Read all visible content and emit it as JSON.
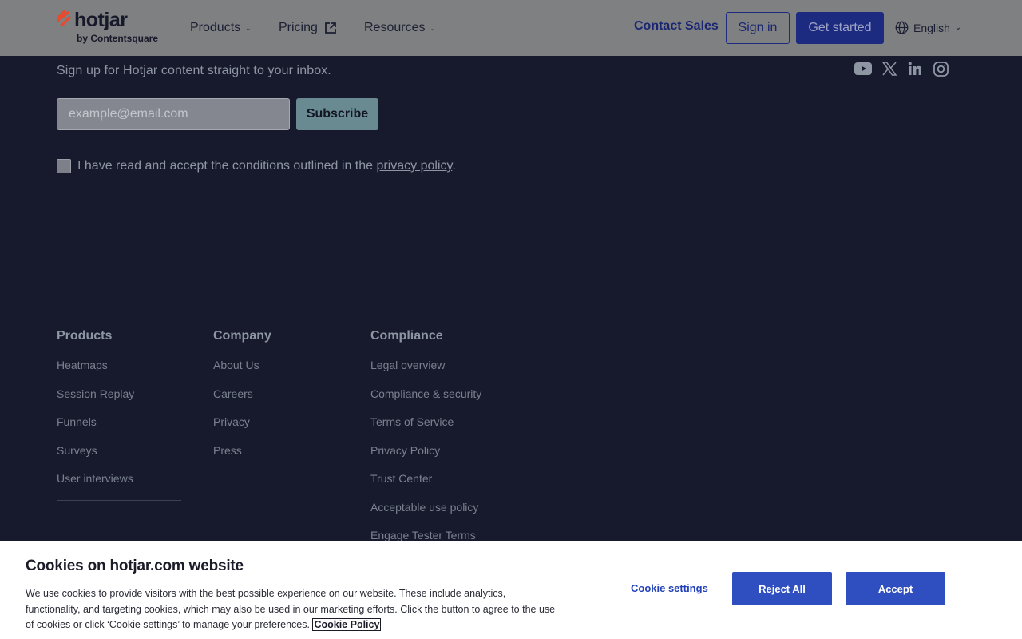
{
  "header": {
    "logo_text": "hotjar",
    "logo_sub": "by Contentsquare",
    "nav": [
      {
        "label": "Products",
        "icon": "chevron-down-icon"
      },
      {
        "label": "Pricing",
        "icon": "external-link-icon"
      },
      {
        "label": "Resources",
        "icon": "chevron-down-icon"
      }
    ],
    "contact_sales": "Contact Sales",
    "sign_in": "Sign in",
    "get_started": "Get started",
    "language": "English"
  },
  "newsletter": {
    "tagline": "Sign up for Hotjar content straight to your inbox.",
    "email_placeholder": "example@email.com",
    "subscribe": "Subscribe",
    "consent_prefix": "I have read and accept the conditions outlined in the ",
    "consent_link": "privacy policy",
    "consent_suffix": "."
  },
  "social": [
    "youtube-icon",
    "x-icon",
    "linkedin-icon",
    "instagram-icon"
  ],
  "columns": [
    {
      "title": "Products",
      "links": [
        "Heatmaps",
        "Session Replay",
        "Funnels",
        "Surveys",
        "User interviews"
      ]
    },
    {
      "title": "Company",
      "links": [
        "About Us",
        "Careers",
        "Privacy",
        "Press"
      ]
    },
    {
      "title": "Compliance",
      "links": [
        "Legal overview",
        "Compliance & security",
        "Terms of Service",
        "Privacy Policy",
        "Trust Center",
        "Acceptable use policy",
        "Engage Tester Terms"
      ]
    }
  ],
  "cookie": {
    "title": "Cookies on hotjar.com website",
    "text": "We use cookies to provide visitors with the best possible experience on our website. These include analytics, functionality, and targeting cookies, which may also be used in our marketing efforts. Click the button to agree to the use of cookies or click ‘Cookie settings’ to manage your preferences.",
    "policy_link": "Cookie Policy",
    "settings": "Cookie settings",
    "reject": "Reject All",
    "accept": "Accept"
  },
  "colors": {
    "footer_bg": "#171a2c",
    "brand_accent": "#ff3c00",
    "primary_button": "#2f4ec0"
  }
}
